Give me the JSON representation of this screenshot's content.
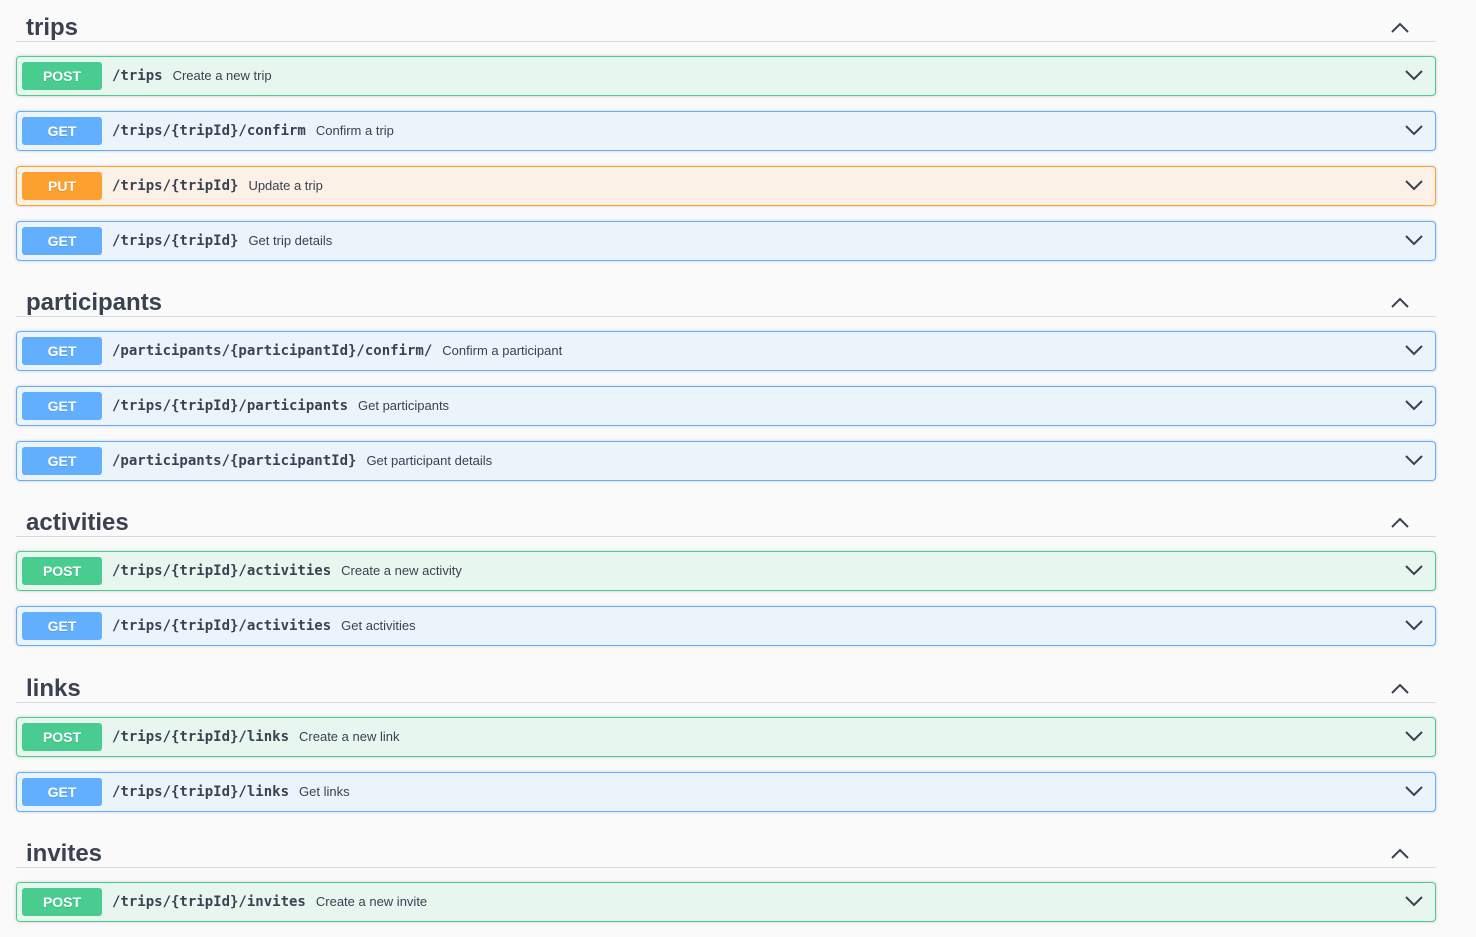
{
  "colors": {
    "post": "#49cc90",
    "get": "#61affe",
    "put": "#fca130"
  },
  "sections": [
    {
      "tag": "trips",
      "toggle_icon": "chevron-up-icon",
      "operations": [
        {
          "method": "POST",
          "path": "/trips",
          "summary": "Create a new trip"
        },
        {
          "method": "GET",
          "path": "/trips/{tripId}/confirm",
          "summary": "Confirm a trip"
        },
        {
          "method": "PUT",
          "path": "/trips/{tripId}",
          "summary": "Update a trip"
        },
        {
          "method": "GET",
          "path": "/trips/{tripId}",
          "summary": "Get trip details"
        }
      ]
    },
    {
      "tag": "participants",
      "toggle_icon": "chevron-up-icon",
      "operations": [
        {
          "method": "GET",
          "path": "/participants/{participantId}/confirm/",
          "summary": "Confirm a participant"
        },
        {
          "method": "GET",
          "path": "/trips/{tripId}/participants",
          "summary": "Get participants"
        },
        {
          "method": "GET",
          "path": "/participants/{participantId}",
          "summary": "Get participant details"
        }
      ]
    },
    {
      "tag": "activities",
      "toggle_icon": "chevron-up-icon",
      "operations": [
        {
          "method": "POST",
          "path": "/trips/{tripId}/activities",
          "summary": "Create a new activity"
        },
        {
          "method": "GET",
          "path": "/trips/{tripId}/activities",
          "summary": "Get activities"
        }
      ]
    },
    {
      "tag": "links",
      "toggle_icon": "chevron-up-icon",
      "operations": [
        {
          "method": "POST",
          "path": "/trips/{tripId}/links",
          "summary": "Create a new link"
        },
        {
          "method": "GET",
          "path": "/trips/{tripId}/links",
          "summary": "Get links"
        }
      ]
    },
    {
      "tag": "invites",
      "toggle_icon": "chevron-up-icon",
      "operations": [
        {
          "method": "POST",
          "path": "/trips/{tripId}/invites",
          "summary": "Create a new invite"
        }
      ]
    }
  ]
}
